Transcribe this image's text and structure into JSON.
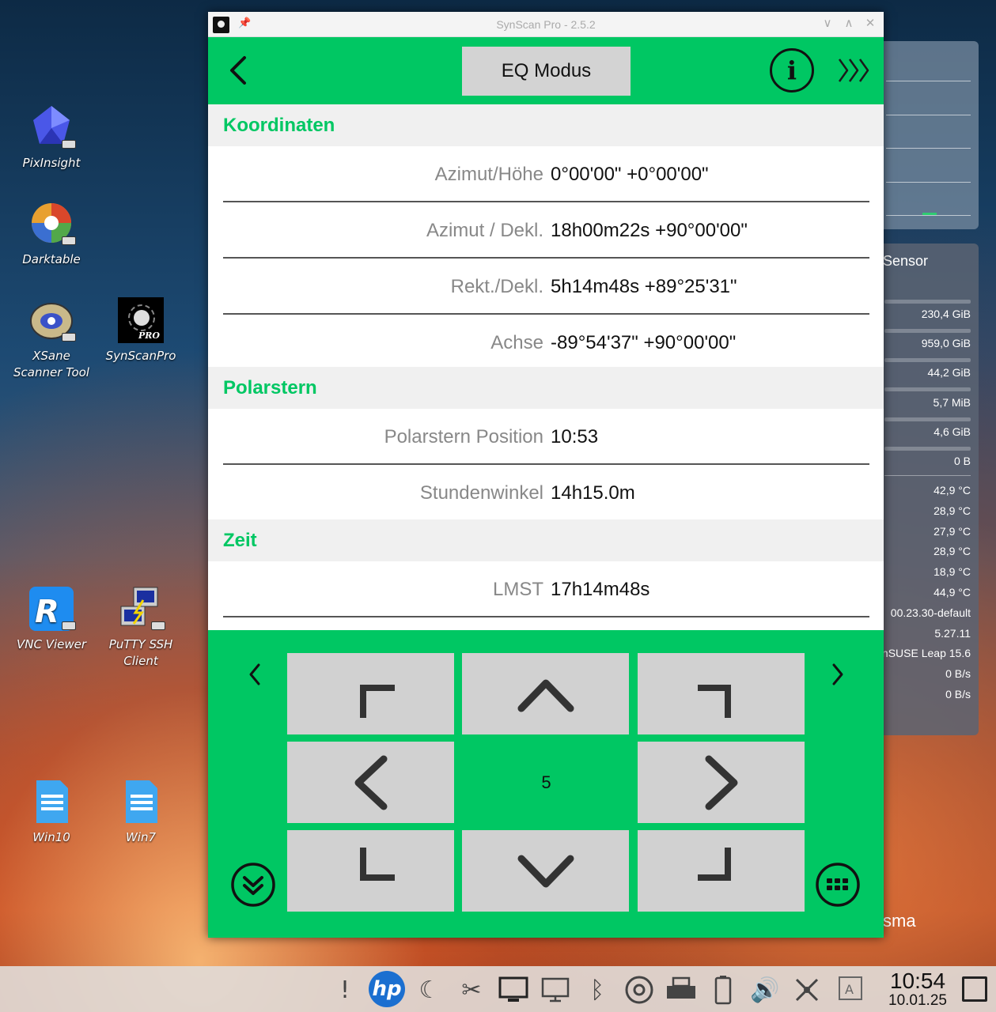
{
  "desktop": {
    "icons": [
      {
        "label": "PixInsight"
      },
      {
        "label": "Darktable"
      },
      {
        "label": "XSane Scanner Tool"
      },
      {
        "label": "SynScanPro"
      },
      {
        "label": "VNC Viewer"
      },
      {
        "label": "PuTTY SSH Client"
      },
      {
        "label": "Win10"
      },
      {
        "label": "Win7"
      }
    ]
  },
  "widget": {
    "header": "Sensor",
    "rows": [
      "230,4 GiB",
      "959,0 GiB",
      "44,2 GiB",
      "5,7 MiB",
      "4,6 GiB",
      "0 B",
      "42,9 °C",
      "28,9 °C",
      "27,9 °C",
      "28,9 °C",
      "18,9 °C",
      "44,9 °C",
      "00.23.30-default",
      "5.27.11",
      "nSUSE Leap 15.6",
      "0 B/s",
      "0 B/s"
    ],
    "plasma_text": "sma"
  },
  "window": {
    "title": "SynScan Pro - 2.5.2",
    "mode_button": "EQ Modus",
    "sections": {
      "koordinaten": {
        "title": "Koordinaten",
        "rows": [
          {
            "label": "Azimut/Höhe",
            "value": "0°00'00\" +0°00'00\""
          },
          {
            "label": "Azimut / Dekl.",
            "value": "18h00m22s +90°00'00\""
          },
          {
            "label": "Rekt./Dekl.",
            "value": "5h14m48s +89°25'31\""
          },
          {
            "label": "Achse",
            "value": "-89°54'37\" +90°00'00\""
          }
        ]
      },
      "polarstern": {
        "title": "Polarstern",
        "rows": [
          {
            "label": "Polarstern Position",
            "value": "10:53"
          },
          {
            "label": "Stundenwinkel",
            "value": "14h15.0m"
          }
        ]
      },
      "zeit": {
        "title": "Zeit",
        "rows": [
          {
            "label": "LMST",
            "value": "17h14m48s"
          }
        ]
      }
    },
    "pad": {
      "speed": "5"
    }
  },
  "taskbar": {
    "time": "10:54",
    "date": "10.01.25",
    "tray_icons": [
      "notification-icon",
      "hp-icon",
      "brightness-icon",
      "tools-icon",
      "display-icon",
      "monitor-icon",
      "bluetooth-icon",
      "disc-icon",
      "printer-icon",
      "battery-icon",
      "volume-icon",
      "network-icon",
      "keyboard-layout-icon"
    ]
  },
  "colors": {
    "accent_green": "#00c763",
    "button_gray": "#d3d3d3"
  }
}
